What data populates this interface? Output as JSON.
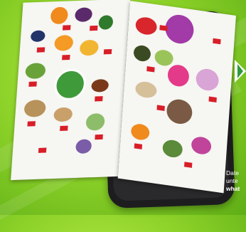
{
  "ad": {
    "text_lines": [
      "Date",
      "unte",
      "what"
    ],
    "colors": {
      "background": "#8fd42a",
      "phone": "#1d1d1f",
      "price_tag": "#d81e28",
      "text": "#ffffff"
    }
  },
  "icons": [
    "brochure-image",
    "smartphone-image",
    "arrow-icon"
  ]
}
